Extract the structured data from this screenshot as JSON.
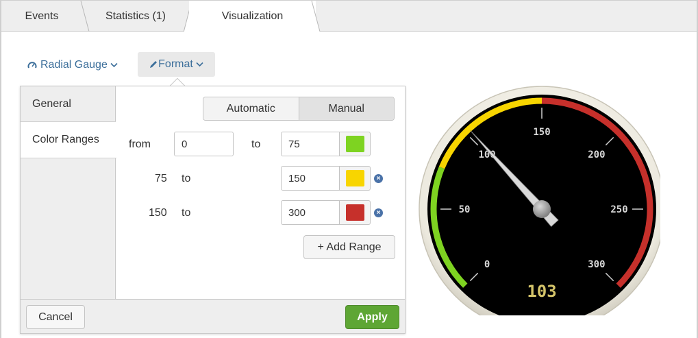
{
  "tabs": [
    {
      "label": "Events"
    },
    {
      "label": "Statistics (1)"
    },
    {
      "label": "Visualization",
      "active": true
    }
  ],
  "toolbar": {
    "viz_type": "Radial Gauge",
    "viz_type_icon": "gauge-icon",
    "format_label": "Format",
    "format_icon": "pencil-icon"
  },
  "format_panel": {
    "sections": [
      {
        "label": "General"
      },
      {
        "label": "Color Ranges",
        "active": true
      }
    ],
    "mode": {
      "automatic": "Automatic",
      "manual": "Manual",
      "selected": "Manual"
    },
    "from_label": "from",
    "to_label": "to",
    "ranges": [
      {
        "from": "0",
        "to": "75",
        "color": "#7ed321"
      },
      {
        "from": "75",
        "to": "150",
        "color": "#f8d500"
      },
      {
        "from": "150",
        "to": "300",
        "color": "#c6302b"
      }
    ],
    "add_range_label": "+ Add Range",
    "cancel_label": "Cancel",
    "apply_label": "Apply"
  },
  "gauge": {
    "value": "103",
    "min": 0,
    "max": 300,
    "current": 103,
    "tick_labels": [
      "0",
      "50",
      "100",
      "150",
      "200",
      "250",
      "300"
    ],
    "band_colors": {
      "low": "#7ed321",
      "mid": "#f8d500",
      "high": "#c6302b"
    }
  }
}
